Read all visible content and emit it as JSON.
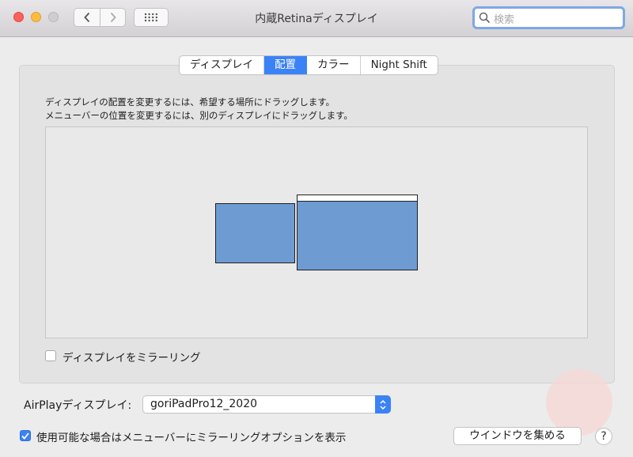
{
  "window": {
    "title": "内蔵Retinaディスプレイ",
    "search_placeholder": "検索"
  },
  "tabs": [
    {
      "label": "ディスプレイ",
      "active": false
    },
    {
      "label": "配置",
      "active": true
    },
    {
      "label": "カラー",
      "active": false
    },
    {
      "label": "Night Shift",
      "active": false
    }
  ],
  "arrangement": {
    "description_line1": "ディスプレイの配置を変更するには、希望する場所にドラッグします。",
    "description_line2": "メニューバーの位置を変更するには、別のディスプレイにドラッグします。"
  },
  "mirror": {
    "label": "ディスプレイをミラーリング",
    "checked": false
  },
  "airplay": {
    "label": "AirPlayディスプレイ:",
    "selected": "goriPadPro12_2020"
  },
  "menubar_option": {
    "label": "使用可能な場合はメニューバーにミラーリングオプションを表示",
    "checked": true
  },
  "buttons": {
    "gather_windows": "ウインドウを集める",
    "help": "?"
  },
  "colors": {
    "accent": "#3c82f7",
    "display_fill": "#6e9bd2"
  }
}
